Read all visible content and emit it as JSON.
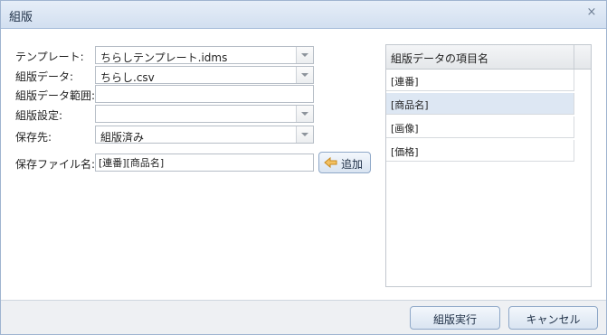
{
  "window": {
    "title": "組版",
    "close_glyph": "×"
  },
  "form": {
    "template": {
      "label": "テンプレート:",
      "value": "ちらしテンプレート.idms"
    },
    "data": {
      "label": "組版データ:",
      "value": "ちらし.csv"
    },
    "range": {
      "label": "組版データ範囲:",
      "value": ""
    },
    "settings": {
      "label": "組版設定:",
      "value": ""
    },
    "destination": {
      "label": "保存先:",
      "value": "組版済み"
    },
    "filename": {
      "label": "保存ファイル名:",
      "value": "[連番][商品名]"
    },
    "add_button": {
      "label": "追加",
      "icon": "arrow-left-icon"
    }
  },
  "fields_grid": {
    "header": "組版データの項目名",
    "rows": [
      {
        "label": "[連番]",
        "selected": false
      },
      {
        "label": "[商品名]",
        "selected": true
      },
      {
        "label": "[画像]",
        "selected": false
      },
      {
        "label": "[価格]",
        "selected": false
      }
    ]
  },
  "footer": {
    "execute_label": "組版実行",
    "cancel_label": "キャンセル"
  },
  "colors": {
    "title_bar": "#d2dff0",
    "selected_row": "#dde7f3",
    "button_border": "#8fa8c8",
    "add_arrow": "#e8a33a"
  }
}
